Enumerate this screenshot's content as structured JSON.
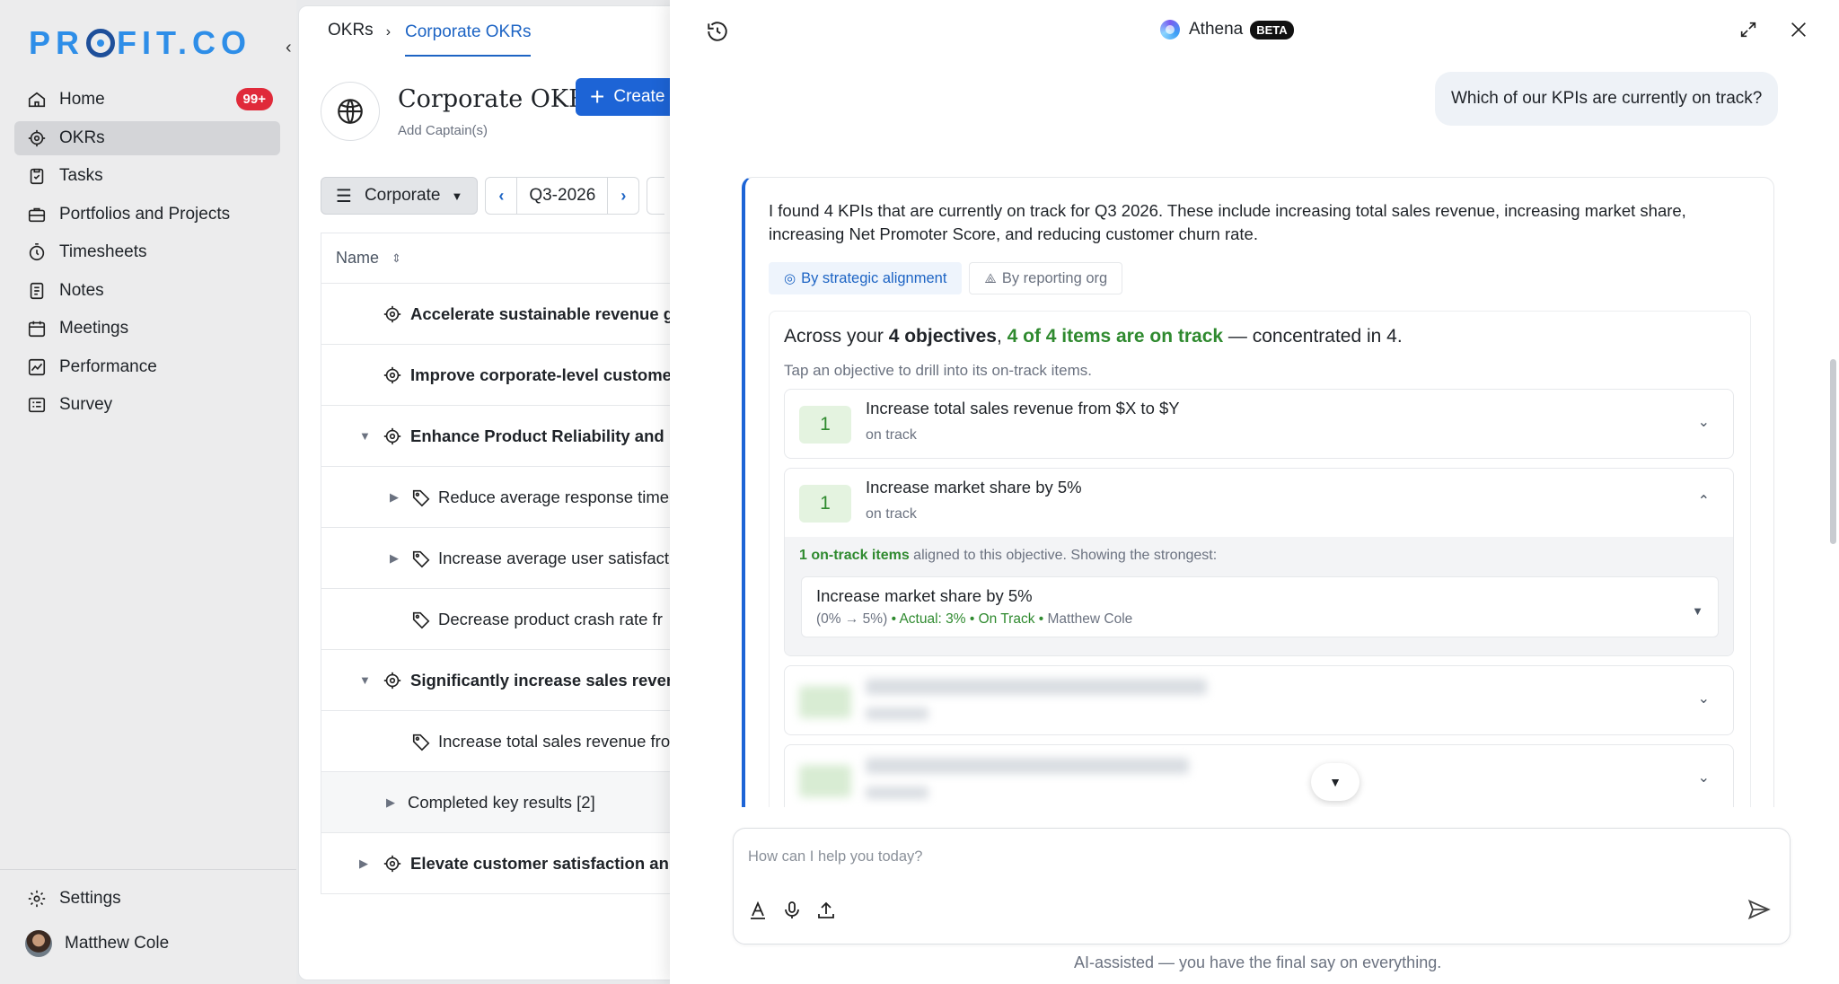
{
  "sidebar": {
    "logo_left": "PR",
    "logo_right": "FIT.CO",
    "items": [
      {
        "label": "Home",
        "badge": "99+"
      },
      {
        "label": "OKRs"
      },
      {
        "label": "Tasks"
      },
      {
        "label": "Portfolios and Projects"
      },
      {
        "label": "Timesheets"
      },
      {
        "label": "Notes"
      },
      {
        "label": "Meetings"
      },
      {
        "label": "Performance"
      },
      {
        "label": "Survey"
      }
    ],
    "settings_label": "Settings",
    "user_name": "Matthew Cole"
  },
  "main": {
    "breadcrumb_root": "OKRs",
    "breadcrumb_active": "Corporate OKRs",
    "title": "Corporate OKRs",
    "create_label": "Create",
    "add_captain": "Add Captain(s)",
    "filter_label": "Corporate",
    "period": "Q3-2026",
    "column_name": "Name",
    "rows": [
      {
        "text": "Accelerate sustainable revenue g",
        "kind": "objective"
      },
      {
        "text": "Improve corporate-level custome",
        "kind": "objective"
      },
      {
        "text": "Enhance Product Reliability and U",
        "kind": "objective"
      },
      {
        "text": "Reduce average response time",
        "kind": "kr"
      },
      {
        "text": "Increase average user satisfact",
        "kind": "kr"
      },
      {
        "text": "Decrease product crash rate fr",
        "kind": "kr"
      },
      {
        "text": "Significantly increase sales reven",
        "kind": "objective"
      },
      {
        "text": "Increase total sales revenue fro",
        "kind": "kr"
      },
      {
        "text": "Completed key results [2]",
        "kind": "group"
      },
      {
        "text": "Elevate customer satisfaction an",
        "kind": "objective"
      }
    ]
  },
  "athena": {
    "title": "Athena",
    "beta": "BETA",
    "user_question": "Which of our KPIs are currently on track?",
    "answer": "I found 4 KPIs that are currently on track for Q3 2026. These include increasing total sales revenue, increasing market share, increasing Net Promoter Score, and reducing customer churn rate.",
    "view_tabs": [
      "By strategic alignment",
      "By reporting org"
    ],
    "summary": {
      "prefix": "Across your",
      "objectives": "4 objectives",
      "on_track": "4 of 4 items are on track",
      "suffix": "— concentrated in 4."
    },
    "hint": "Tap an objective to drill into its on-track items.",
    "objective_cards": [
      {
        "count": "1",
        "title": "Increase total sales revenue from $X to $Y",
        "status": "on track"
      },
      {
        "count": "1",
        "title": "Increase market share by 5%",
        "status": "on track"
      }
    ],
    "expand_note_strong": "1 on-track items",
    "expand_note_rest": "aligned to this objective. Showing the strongest:",
    "kr": {
      "title": "Increase market share by 5%",
      "range": "(0%  →  5%)",
      "actual": "• Actual: 3% • On Track •",
      "owner": "Matthew Cole"
    },
    "composer_placeholder": "How can I help you today?",
    "footer": "AI-assisted — you have the final say on everything."
  },
  "colors": {
    "accent": "#1d64d6",
    "on_track_green": "#2f8a2f",
    "badge_red": "#e02a3a"
  }
}
